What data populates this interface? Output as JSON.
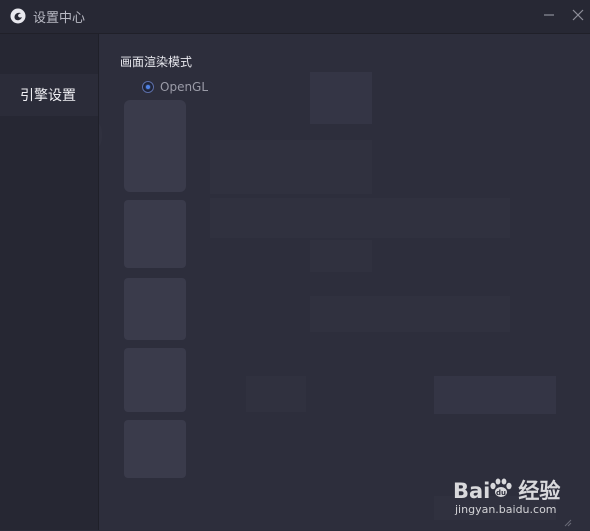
{
  "window": {
    "title": "设置中心"
  },
  "sidebar": {
    "items": [
      {
        "label": "引擎设置",
        "selected": true
      }
    ]
  },
  "main": {
    "section_title": "画面渲染模式",
    "render_mode": {
      "options": [
        {
          "label": "OpenGL",
          "checked": true
        }
      ]
    }
  },
  "watermark": {
    "brand_left": "Bai",
    "brand_right": "经验",
    "url": "jingyan.baidu.com"
  },
  "colors": {
    "background": "#2d2e3c",
    "titlebar": "#272834",
    "sidebar": "#262733",
    "accent": "#4f82e6"
  },
  "icons": {
    "app_logo": "app-logo-icon",
    "minimize": "minimize-icon",
    "close": "close-icon"
  }
}
